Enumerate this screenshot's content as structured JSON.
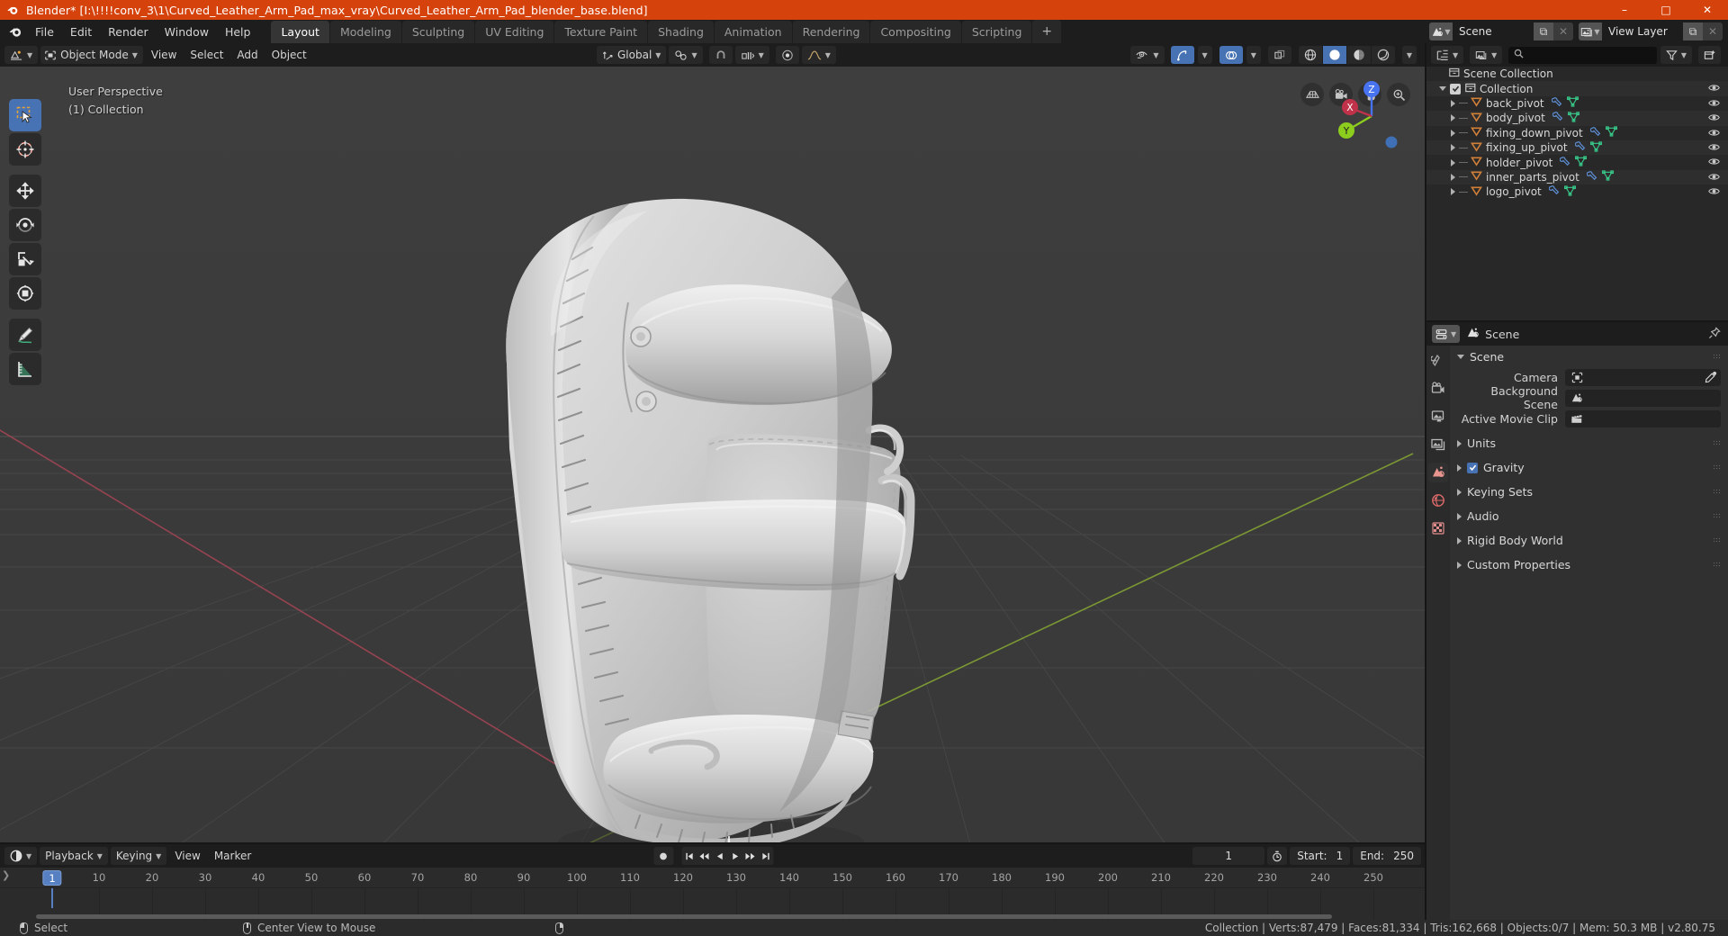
{
  "titlebar": {
    "text": "Blender* [I:\\!!!!conv_3\\1\\Curved_Leather_Arm_Pad_max_vray\\Curved_Leather_Arm_Pad_blender_base.blend]",
    "app_icon": "blender-icon",
    "minimize": "–",
    "maximize": "□",
    "close": "✕"
  },
  "topbar": {
    "menus": [
      "File",
      "Edit",
      "Render",
      "Window",
      "Help"
    ],
    "workspaces": [
      {
        "label": "Layout",
        "active": true
      },
      {
        "label": "Modeling",
        "active": false
      },
      {
        "label": "Sculpting",
        "active": false
      },
      {
        "label": "UV Editing",
        "active": false
      },
      {
        "label": "Texture Paint",
        "active": false
      },
      {
        "label": "Shading",
        "active": false
      },
      {
        "label": "Animation",
        "active": false
      },
      {
        "label": "Rendering",
        "active": false
      },
      {
        "label": "Compositing",
        "active": false
      },
      {
        "label": "Scripting",
        "active": false
      }
    ],
    "add_workspace": "+",
    "scene": {
      "name": "Scene",
      "icon": "scene-icon",
      "new_label": "⧉",
      "unlink_label": "✕"
    },
    "view_layer": {
      "name": "View Layer",
      "icon": "view-layer-icon",
      "new_label": "⧉",
      "unlink_label": "✕"
    }
  },
  "viewport": {
    "mode": "Object Mode",
    "mode_icon": "object-mode-icon",
    "editor_icon": "editor-type-icon",
    "menus": [
      "View",
      "Select",
      "Add",
      "Object"
    ],
    "transform_orientation": "Global",
    "transform_orientation_icon": "orientation-icon",
    "pivot_icon": "pivot-point-icon",
    "snap_magnet_icon": "magnet-icon",
    "snap_target_icon": "snap-increment-icon",
    "proportional_icon": "proportional-edit-icon",
    "falloff_icon": "smooth-falloff-icon",
    "right_controls": {
      "visibility_icon": "object-visibility-icon",
      "gizmo_icon": "gizmo-icon",
      "gizmo_on": true,
      "overlays_icon": "overlays-icon",
      "overlays_on": true,
      "xray_icon": "xray-toggle-icon",
      "shading_modes": [
        "wireframe-shading-icon",
        "solid-shading-icon",
        "material-shading-icon",
        "rendered-shading-icon"
      ],
      "active_shading_index": 1
    },
    "overlay_text": {
      "perspective": "User Perspective",
      "collection": "(1) Collection"
    },
    "tools": [
      {
        "name": "tweak-select-tool",
        "active": true
      },
      {
        "name": "cursor-tool",
        "active": false
      },
      {
        "name": "move-tool",
        "active": false
      },
      {
        "name": "rotate-tool",
        "active": false
      },
      {
        "name": "scale-tool",
        "active": false
      },
      {
        "name": "transform-tool",
        "active": false
      },
      {
        "name": "annotate-tool",
        "active": false
      },
      {
        "name": "measure-tool",
        "active": false
      }
    ],
    "nav_buttons": [
      "toggle-orthographic-icon",
      "camera-view-icon",
      "pan-view-icon",
      "zoom-view-icon"
    ],
    "gizmo_axes": [
      {
        "label": "Z",
        "color": "#4772f0"
      },
      {
        "label": "X",
        "color": "#c0324a"
      },
      {
        "label": "Y",
        "color": "#8dcd1e"
      }
    ]
  },
  "outliner": {
    "editor_icon": "outliner-editor-icon",
    "display_mode_icon": "view-layer-display-icon",
    "search_placeholder": "",
    "search_icon": "search-icon",
    "filter_icon": "filter-icon",
    "new_collection_icon": "new-collection-icon",
    "rows": [
      {
        "label": "Scene Collection",
        "indent": 0,
        "icon": "scene-collection-icon",
        "type": "collection",
        "disclosure": "",
        "checkbox": false,
        "modifiers": [],
        "eye": false
      },
      {
        "label": "Collection",
        "indent": 1,
        "icon": "collection-icon",
        "type": "collection",
        "disclosure": "down",
        "checkbox": true,
        "modifiers": [],
        "eye": true
      },
      {
        "label": "back_pivot",
        "indent": 2,
        "icon": "empty-object-icon",
        "type": "object",
        "disclosure": "right",
        "checkbox": false,
        "modifiers": [
          "modifier-icon",
          "mesh-data-icon"
        ],
        "eye": true
      },
      {
        "label": "body_pivot",
        "indent": 2,
        "icon": "empty-object-icon",
        "type": "object",
        "disclosure": "right",
        "checkbox": false,
        "modifiers": [
          "modifier-icon",
          "mesh-data-icon"
        ],
        "eye": true
      },
      {
        "label": "fixing_down_pivot",
        "indent": 2,
        "icon": "empty-object-icon",
        "type": "object",
        "disclosure": "right",
        "checkbox": false,
        "modifiers": [
          "modifier-icon",
          "mesh-data-icon"
        ],
        "eye": true
      },
      {
        "label": "fixing_up_pivot",
        "indent": 2,
        "icon": "empty-object-icon",
        "type": "object",
        "disclosure": "right",
        "checkbox": false,
        "modifiers": [
          "modifier-icon",
          "mesh-data-icon"
        ],
        "eye": true
      },
      {
        "label": "holder_pivot",
        "indent": 2,
        "icon": "empty-object-icon",
        "type": "object",
        "disclosure": "right",
        "checkbox": false,
        "modifiers": [
          "modifier-icon",
          "mesh-data-icon"
        ],
        "eye": true
      },
      {
        "label": "inner_parts_pivot",
        "indent": 2,
        "icon": "empty-object-icon",
        "type": "object",
        "disclosure": "right",
        "checkbox": false,
        "modifiers": [
          "modifier-icon",
          "mesh-data-icon"
        ],
        "eye": true
      },
      {
        "label": "logo_pivot",
        "indent": 2,
        "icon": "empty-object-icon",
        "type": "object",
        "disclosure": "right",
        "checkbox": false,
        "modifiers": [
          "modifier-icon",
          "mesh-data-icon"
        ],
        "eye": true
      }
    ]
  },
  "properties": {
    "editor_icon": "properties-editor-icon",
    "breadcrumb_icon": "scene-icon",
    "breadcrumb": "Scene",
    "pin_icon": "pin-icon",
    "tabs": [
      {
        "name": "tool-tab",
        "icon": "tool-icon",
        "active": false
      },
      {
        "name": "render-tab",
        "icon": "render-icon",
        "active": false
      },
      {
        "name": "output-tab",
        "icon": "output-icon",
        "active": false
      },
      {
        "name": "view-layer-tab",
        "icon": "view-layer-icon",
        "active": false
      },
      {
        "name": "scene-tab",
        "icon": "scene-icon",
        "active": true
      },
      {
        "name": "world-tab",
        "icon": "world-icon",
        "active": false
      },
      {
        "name": "texture-tab",
        "icon": "texture-icon",
        "active": false
      }
    ],
    "panels": [
      {
        "label": "Scene",
        "open": true,
        "grip": true
      },
      {
        "label": "Units",
        "open": false,
        "grip": true
      },
      {
        "label": "Gravity",
        "open": false,
        "grip": true,
        "checkbox": true
      },
      {
        "label": "Keying Sets",
        "open": false,
        "grip": true
      },
      {
        "label": "Audio",
        "open": false,
        "grip": true
      },
      {
        "label": "Rigid Body World",
        "open": false,
        "grip": true
      },
      {
        "label": "Custom Properties",
        "open": false,
        "grip": true
      }
    ],
    "scene_fields": [
      {
        "label": "Camera",
        "value": "",
        "icon": "camera-data-icon",
        "eyedropper": true
      },
      {
        "label": "Background Scene",
        "value": "",
        "icon": "scene-icon",
        "eyedropper": false
      },
      {
        "label": "Active Movie Clip",
        "value": "",
        "icon": "movie-clip-icon",
        "eyedropper": false
      }
    ]
  },
  "timeline": {
    "editor_icon": "timeline-editor-icon",
    "menus": [
      {
        "label": "Playback",
        "caret": true
      },
      {
        "label": "Keying",
        "caret": true
      },
      {
        "label": "View",
        "caret": false
      },
      {
        "label": "Marker",
        "caret": false
      }
    ],
    "record_icon": "auto-keying-icon",
    "transport": [
      "jump-to-start-icon",
      "jump-prev-keyframe-icon",
      "play-reverse-icon",
      "play-icon",
      "jump-next-keyframe-icon",
      "jump-to-end-icon"
    ],
    "current_frame": "1",
    "frame_clock_icon": "use-preview-range-icon",
    "start_label": "Start:",
    "start_value": "1",
    "end_label": "End:",
    "end_value": "250",
    "ticks": [
      "1",
      "10",
      "20",
      "30",
      "40",
      "50",
      "60",
      "70",
      "80",
      "90",
      "100",
      "110",
      "120",
      "130",
      "140",
      "150",
      "160",
      "170",
      "180",
      "190",
      "200",
      "210",
      "220",
      "230",
      "240",
      "250"
    ],
    "playhead_frame": "1"
  },
  "statusbar": {
    "keymap": [
      {
        "icon": "mouse-left-icon",
        "label": "Select"
      },
      {
        "icon": "mouse-middle-icon",
        "label": "Center View to Mouse"
      },
      {
        "icon": "mouse-right-icon",
        "label": ""
      }
    ],
    "stats": "Collection | Verts:87,479 | Faces:81,334 | Tris:162,668 | Objects:0/7 | Mem: 50.3 MB | v2.80.75"
  },
  "colors": {
    "accent_orange": "#d6420b",
    "accent_blue": "#4772b3",
    "axis_x": "#c0324a",
    "axis_y": "#8dcd1e",
    "axis_z": "#4772f0",
    "panel_bg": "#303030",
    "header_bg": "#1d1d1d"
  }
}
